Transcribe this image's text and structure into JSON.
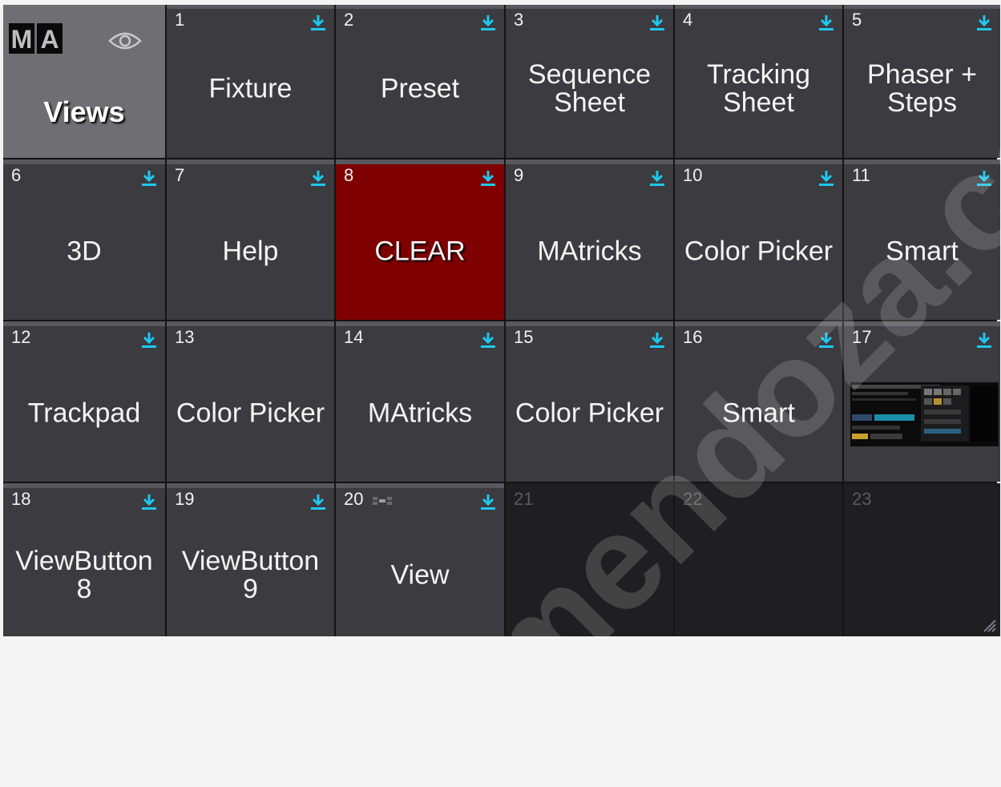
{
  "header": {
    "logo_letters": [
      "M",
      "A"
    ],
    "title": "Views"
  },
  "tiles": [
    {
      "num": "1",
      "label": "Fixture",
      "store": true
    },
    {
      "num": "2",
      "label": "Preset",
      "store": true
    },
    {
      "num": "3",
      "label": "Sequence\nSheet",
      "store": true
    },
    {
      "num": "4",
      "label": "Tracking\nSheet",
      "store": true
    },
    {
      "num": "5",
      "label": "Phaser +\nSteps",
      "store": true
    },
    {
      "num": "6",
      "label": "3D",
      "store": true
    },
    {
      "num": "7",
      "label": "Help",
      "store": true
    },
    {
      "num": "8",
      "label": "CLEAR",
      "store": true,
      "color": "#7e0000"
    },
    {
      "num": "9",
      "label": "MAtricks",
      "store": true
    },
    {
      "num": "10",
      "label": "Color Picker",
      "store": true
    },
    {
      "num": "11",
      "label": "Smart",
      "store": true
    },
    {
      "num": "12",
      "label": "Trackpad",
      "store": true
    },
    {
      "num": "13",
      "label": "Color Picker",
      "store": false
    },
    {
      "num": "14",
      "label": "MAtricks",
      "store": true
    },
    {
      "num": "15",
      "label": "Color Picker",
      "store": true
    },
    {
      "num": "16",
      "label": "Smart",
      "store": true
    },
    {
      "num": "17",
      "label": "",
      "store": true,
      "thumbnail": "view-screenshot-thumbnail"
    },
    {
      "num": "18",
      "label": "ViewButton\n8",
      "store": true
    },
    {
      "num": "19",
      "label": "ViewButton\n9",
      "store": true
    },
    {
      "num": "20",
      "label": "View",
      "store": true,
      "mini_icon": "view-layout-icon"
    },
    {
      "num": "21",
      "label": "",
      "empty": true
    },
    {
      "num": "22",
      "label": "",
      "empty": true
    },
    {
      "num": "23",
      "label": "",
      "empty": true
    }
  ],
  "icons": {
    "store": "store-arrow-icon",
    "eye": "eye-icon",
    "grip": "resize-grip-icon"
  },
  "colors": {
    "tile_bg": "#3b3b40",
    "tile_top_bar": "#58585e",
    "header_bg": "#6e6e73",
    "clear_bg": "#7e0000",
    "store_icon": "#1ec8f0",
    "empty_bg": "#1f1f21"
  },
  "watermark": "smendoza.com"
}
